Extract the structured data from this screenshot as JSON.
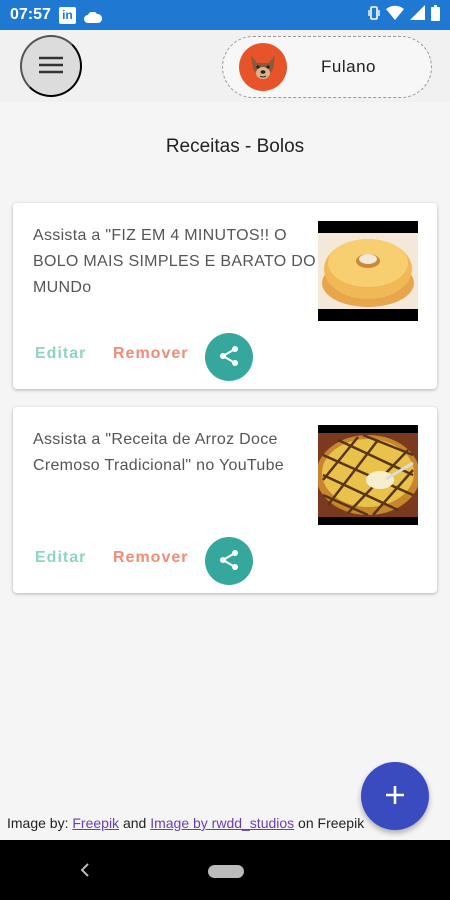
{
  "status_bar": {
    "time": "07:57",
    "linkedin_label": "in"
  },
  "appbar": {
    "user_name": "Fulano"
  },
  "page_title": "Receitas - Bolos",
  "cards": [
    {
      "text": "Assista a \"FIZ EM 4 MINUTOS!! O BOLO MAIS SIMPLES E BARATO DO MUNDo",
      "edit_label": "Editar",
      "remove_label": "Remover"
    },
    {
      "text": "Assista a \"Receita de Arroz Doce Cremoso Tradicional\" no YouTube",
      "edit_label": "Editar",
      "remove_label": "Remover"
    }
  ],
  "credits": {
    "prefix": "Image by: ",
    "link1": "Freepik",
    "mid": " and ",
    "link2": "Image by rwdd_studios",
    "suffix": " on Freepik"
  },
  "colors": {
    "status_bar": "#1f78d1",
    "accent_edit": "#8fd3c4",
    "accent_remove": "#f08c78",
    "share": "#36a79c",
    "fab": "#3a4bbf",
    "avatar": "#e8542a"
  },
  "icons": {
    "menu": "menu-icon",
    "share": "share-icon",
    "fab": "plus-icon",
    "back": "chevron-left-icon"
  }
}
